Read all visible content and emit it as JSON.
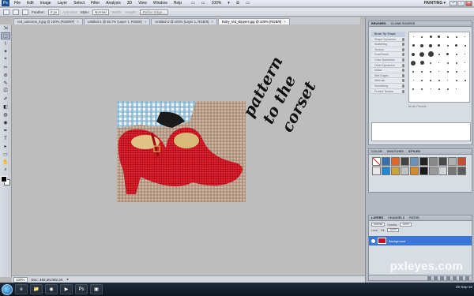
{
  "app": {
    "logo": "Ps",
    "workspace": "PAINTING ▾"
  },
  "menu": [
    "File",
    "Edit",
    "Image",
    "Layer",
    "Select",
    "Filter",
    "Analysis",
    "3D",
    "View",
    "Window",
    "Help"
  ],
  "menu_extras": [
    "▭",
    "▭",
    "100%",
    "▾",
    "☰",
    "▭"
  ],
  "window_buttons": [
    "–",
    "▫",
    "✕"
  ],
  "options": {
    "feather_label": "Feather:",
    "feather_value": "0 px",
    "antialias_label": "Anti-alias",
    "style_label": "Style:",
    "style_value": "Normal",
    "width_label": "Width:",
    "height_label": "Height:",
    "refine_label": "Refine Edge..."
  },
  "tabs": [
    {
      "label": "red_unmoros_d.jpg @ 100% (RGB/8#)",
      "active": false
    },
    {
      "label": "Untitled-1 @ 66.7% (Layer 1, RGB/8)",
      "active": false
    },
    {
      "label": "Untitled-2 @ 100% (Layer 1, RGB/8)",
      "active": false
    },
    {
      "label": "Ruby_red_slippers.jpg @ 100% (RGB/8)",
      "active": true
    }
  ],
  "tools": [
    "⇲",
    "⬚",
    "⌇",
    "✦",
    "⌖",
    "✂",
    "⊘",
    "✎",
    "⎚",
    "✐",
    "◧",
    "◍",
    "◉",
    "✒",
    "T",
    "▸",
    "▭",
    "✋",
    "⌕"
  ],
  "handwriting": [
    "pattern",
    "to the",
    "corset"
  ],
  "status": {
    "zoom": "100%",
    "doc": "Doc: 492.2K/492.2K",
    "arrow": "▸"
  },
  "brushes_panel": {
    "tabs": [
      "BRUSHES",
      "CLONE SOURCE"
    ],
    "presets": [
      "Brush Tip Shape",
      "Shape Dynamics",
      "Scattering",
      "Texture",
      "Dual Brush",
      "Color Dynamics",
      "Other Dynamics",
      "Noise",
      "Wet Edges",
      "Airbrush",
      "Smoothing",
      "Protect Texture"
    ],
    "brush_tip_label": "Brush Presets"
  },
  "styles_panel": {
    "tabs": [
      "COLOR",
      "SWATCHES",
      "STYLES"
    ]
  },
  "layers_panel": {
    "tabs": [
      "LAYERS",
      "CHANNELS",
      "PATHS"
    ],
    "blend": "Normal",
    "opacity_label": "Opacity:",
    "opacity": "100%",
    "lock_label": "Lock:",
    "fill_label": "Fill:",
    "fill": "100%",
    "layer_name": "Background"
  },
  "taskbar": {
    "icons": [
      "e",
      "📁",
      "◉",
      "▶",
      "Ps",
      "▣"
    ]
  },
  "watermark": "pxleyes.com",
  "clock": {
    "date": "25-Sep-10"
  }
}
